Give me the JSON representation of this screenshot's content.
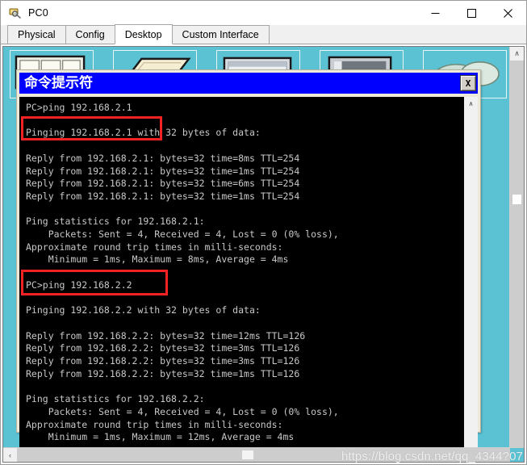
{
  "window": {
    "title": "PC0",
    "icon": "pc-device-icon",
    "controls": {
      "minimize": "—",
      "maximize": "□",
      "close": "✕"
    }
  },
  "tabs": [
    {
      "label": "Physical",
      "active": false
    },
    {
      "label": "Config",
      "active": false
    },
    {
      "label": "Desktop",
      "active": true
    },
    {
      "label": "Custom Interface",
      "active": false
    }
  ],
  "desktop": {
    "background_color": "#5bc2d4",
    "icons": [
      {
        "name": "ip-configuration-icon"
      },
      {
        "name": "dial-up-icon"
      },
      {
        "name": "terminal-icon"
      },
      {
        "name": "command-prompt-icon"
      },
      {
        "name": "web-browser-icon"
      }
    ]
  },
  "cmd_window": {
    "title": "命令提示符",
    "title_bar_color": "#0000ff",
    "close_button": "X",
    "scroll_up": "∧",
    "scroll_down": "∨",
    "terminal": {
      "background": "#000000",
      "foreground": "#c8c8c8",
      "lines": "PC>ping 192.168.2.1\n\nPinging 192.168.2.1 with 32 bytes of data:\n\nReply from 192.168.2.1: bytes=32 time=8ms TTL=254\nReply from 192.168.2.1: bytes=32 time=1ms TTL=254\nReply from 192.168.2.1: bytes=32 time=6ms TTL=254\nReply from 192.168.2.1: bytes=32 time=1ms TTL=254\n\nPing statistics for 192.168.2.1:\n    Packets: Sent = 4, Received = 4, Lost = 0 (0% loss),\nApproximate round trip times in milli-seconds:\n    Minimum = 1ms, Maximum = 8ms, Average = 4ms\n\nPC>ping 192.168.2.2\n\nPinging 192.168.2.2 with 32 bytes of data:\n\nReply from 192.168.2.2: bytes=32 time=12ms TTL=126\nReply from 192.168.2.2: bytes=32 time=3ms TTL=126\nReply from 192.168.2.2: bytes=32 time=3ms TTL=126\nReply from 192.168.2.2: bytes=32 time=1ms TTL=126\n\nPing statistics for 192.168.2.2:\n    Packets: Sent = 4, Received = 4, Lost = 0 (0% loss),\nApproximate round trip times in milli-seconds:\n    Minimum = 1ms, Maximum = 12ms, Average = 4ms\n\nPC>"
    }
  },
  "annotations": {
    "color": "#f42222",
    "boxes": [
      {
        "label": "highlight-ping-command-1"
      },
      {
        "label": "highlight-ping-command-2"
      }
    ]
  },
  "scrollbars": {
    "left_arrow": "‹",
    "up_arrow": "∧"
  },
  "watermark": "https://blog.csdn.net/qq_4344?07"
}
